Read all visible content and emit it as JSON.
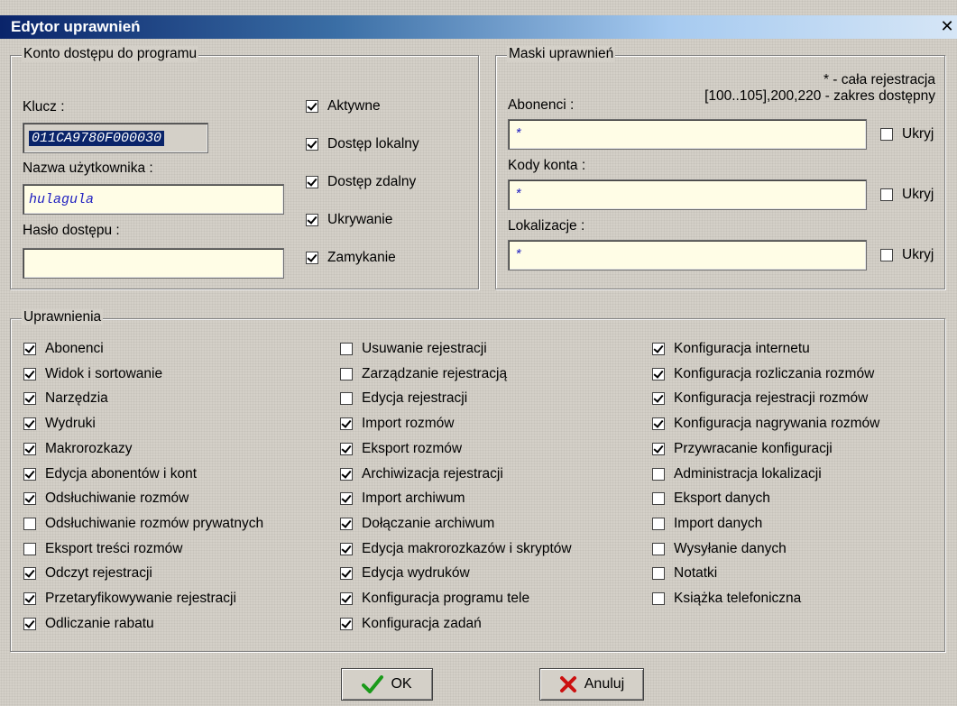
{
  "window": {
    "title": "Edytor uprawnień",
    "close_symbol": "✕"
  },
  "account": {
    "legend": "Konto dostępu do programu",
    "key_label": "Klucz :",
    "key_value": "011CA9780F000030",
    "user_label": "Nazwa użytkownika :",
    "user_value": "hulagula",
    "password_label": "Hasło dostępu :",
    "password_value": "",
    "flags": [
      {
        "label": "Aktywne",
        "checked": true
      },
      {
        "label": "Dostęp lokalny",
        "checked": true
      },
      {
        "label": "Dostęp zdalny",
        "checked": true
      },
      {
        "label": "Ukrywanie",
        "checked": true
      },
      {
        "label": "Zamykanie",
        "checked": true
      }
    ]
  },
  "masks": {
    "legend": "Maski uprawnień",
    "hint_line1": "* - cała rejestracja",
    "hint_line2": "[100..105],200,220 - zakres dostępny",
    "hide_label": "Ukryj",
    "rows": [
      {
        "label": "Abonenci :",
        "value": "*",
        "hide": false
      },
      {
        "label": "Kody konta :",
        "value": "*",
        "hide": false
      },
      {
        "label": "Lokalizacje :",
        "value": "*",
        "hide": false
      }
    ]
  },
  "permissions": {
    "legend": "Uprawnienia",
    "col1": [
      {
        "label": "Abonenci",
        "checked": true
      },
      {
        "label": "Widok i sortowanie",
        "checked": true
      },
      {
        "label": "Narzędzia",
        "checked": true
      },
      {
        "label": "Wydruki",
        "checked": true
      },
      {
        "label": "Makrorozkazy",
        "checked": true
      },
      {
        "label": "Edycja abonentów i kont",
        "checked": true
      },
      {
        "label": "Odsłuchiwanie rozmów",
        "checked": true
      },
      {
        "label": "Odsłuchiwanie rozmów prywatnych",
        "checked": false
      },
      {
        "label": "Eksport treści rozmów",
        "checked": false
      },
      {
        "label": "Odczyt rejestracji",
        "checked": true
      },
      {
        "label": "Przetaryfikowywanie rejestracji",
        "checked": true
      },
      {
        "label": "Odliczanie rabatu",
        "checked": true
      }
    ],
    "col2": [
      {
        "label": "Usuwanie rejestracji",
        "checked": false
      },
      {
        "label": "Zarządzanie rejestracją",
        "checked": false
      },
      {
        "label": "Edycja rejestracji",
        "checked": false
      },
      {
        "label": "Import rozmów",
        "checked": true
      },
      {
        "label": "Eksport rozmów",
        "checked": true
      },
      {
        "label": "Archiwizacja rejestracji",
        "checked": true
      },
      {
        "label": "Import archiwum",
        "checked": true
      },
      {
        "label": "Dołączanie archiwum",
        "checked": true
      },
      {
        "label": "Edycja makrorozkazów i skryptów",
        "checked": true
      },
      {
        "label": "Edycja wydruków",
        "checked": true
      },
      {
        "label": "Konfiguracja programu tele",
        "checked": true
      },
      {
        "label": "Konfiguracja zadań",
        "checked": true
      }
    ],
    "col3": [
      {
        "label": "Konfiguracja internetu",
        "checked": true
      },
      {
        "label": "Konfiguracja rozliczania rozmów",
        "checked": true
      },
      {
        "label": "Konfiguracja rejestracji rozmów",
        "checked": true
      },
      {
        "label": "Konfiguracja nagrywania rozmów",
        "checked": true
      },
      {
        "label": "Przywracanie konfiguracji",
        "checked": true
      },
      {
        "label": "Administracja lokalizacji",
        "checked": false
      },
      {
        "label": "Eksport danych",
        "checked": false
      },
      {
        "label": "Import danych",
        "checked": false
      },
      {
        "label": "Wysyłanie danych",
        "checked": false
      },
      {
        "label": "Notatki",
        "checked": false
      },
      {
        "label": "Książka telefoniczna",
        "checked": false
      }
    ]
  },
  "buttons": {
    "ok_label": "OK",
    "ok_icon": "checkmark-icon",
    "ok_color": "#1a9a1a",
    "cancel_label": "Anuluj",
    "cancel_icon": "x-icon",
    "cancel_color": "#cc1010"
  }
}
